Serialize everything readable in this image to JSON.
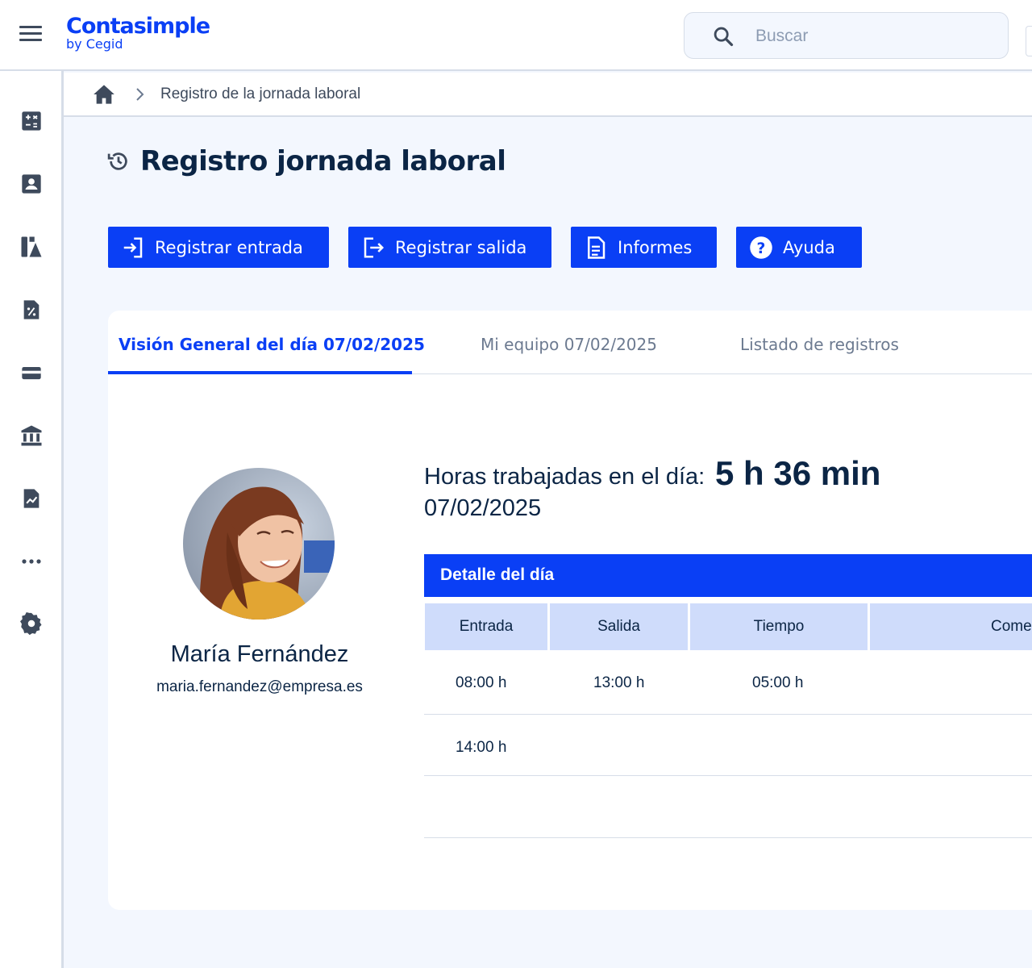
{
  "header": {
    "logo_main": "Contasimple",
    "logo_sub": "by Cegid",
    "search_placeholder": "Buscar"
  },
  "sidebar": {
    "items": [
      {
        "icon": "calculator-icon"
      },
      {
        "icon": "contact-card-icon"
      },
      {
        "icon": "products-icon"
      },
      {
        "icon": "invoice-percent-icon"
      },
      {
        "icon": "wallet-icon"
      },
      {
        "icon": "bank-icon"
      },
      {
        "icon": "report-chart-icon"
      },
      {
        "icon": "more-icon"
      },
      {
        "icon": "settings-icon"
      }
    ]
  },
  "breadcrumb": {
    "current": "Registro de la jornada laboral"
  },
  "page": {
    "title": "Registro jornada laboral"
  },
  "actions": {
    "entrada": "Registrar entrada",
    "salida": "Registrar salida",
    "informes": "Informes",
    "ayuda": "Ayuda"
  },
  "tabs": [
    {
      "label": "Visión General del día 07/02/2025",
      "active": true
    },
    {
      "label": "Mi equipo 07/02/2025",
      "active": false
    },
    {
      "label": "Listado de registros",
      "active": false
    }
  ],
  "user": {
    "name": "María Fernández",
    "email": "maria.fernandez@empresa.es"
  },
  "summary": {
    "hours_label": "Horas trabajadas en el día:",
    "hours_value": "5 h 36 min",
    "date": "07/02/2025"
  },
  "detail": {
    "title": "Detalle del día",
    "columns": [
      "Entrada",
      "Salida",
      "Tiempo",
      "Come"
    ],
    "rows": [
      {
        "entrada": "08:00 h",
        "salida": "13:00 h",
        "tiempo": "05:00 h"
      },
      {
        "entrada": "14:00 h",
        "salida": "",
        "tiempo": ""
      }
    ]
  },
  "colors": {
    "brand": "#0a3ff5",
    "text": "#0b2545",
    "background": "#f3f7fe",
    "table_header": "#cfdcfb"
  }
}
